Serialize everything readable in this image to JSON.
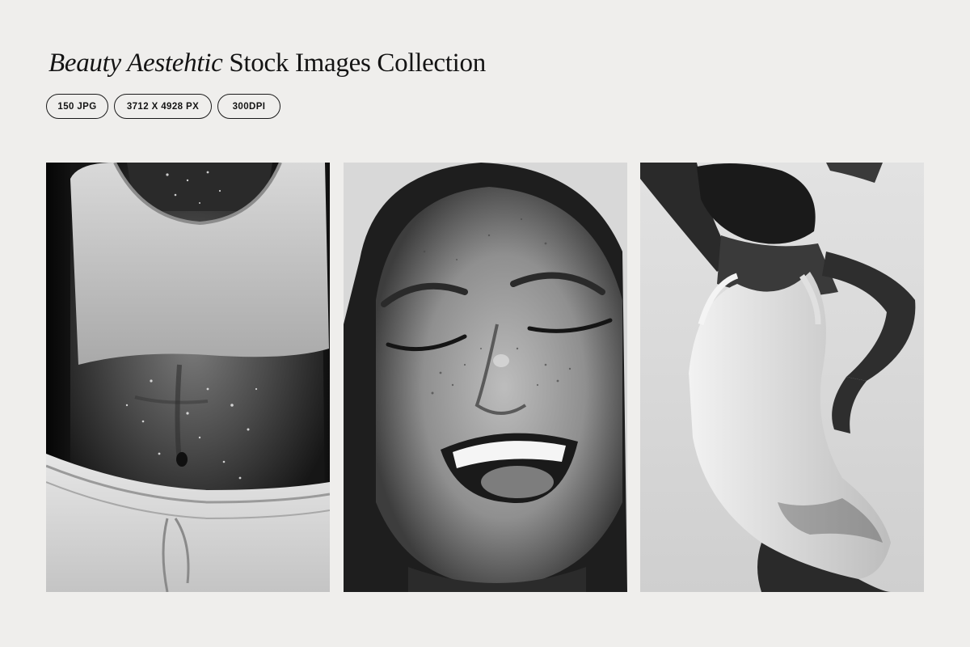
{
  "header": {
    "title_italic": "Beauty Aestehtic",
    "title_rest": " Stock Images Collection"
  },
  "badges": [
    {
      "label": "150 JPG"
    },
    {
      "label": "3712 X 4928 PX"
    },
    {
      "label": "300DPI"
    }
  ],
  "gallery": {
    "photos": [
      {
        "subject": "midriff-with-water-droplets"
      },
      {
        "subject": "laughing-freckled-face"
      },
      {
        "subject": "dancer-in-white-bodysuit"
      }
    ]
  },
  "colors": {
    "background": "#efeeec",
    "text": "#141414"
  }
}
